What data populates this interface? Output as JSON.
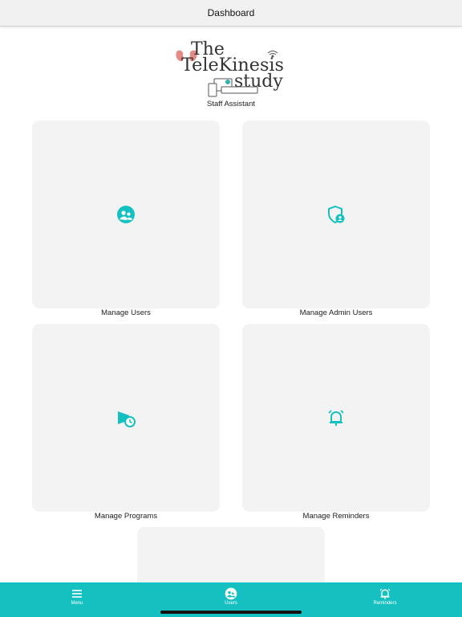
{
  "header": {
    "title": "Dashboard"
  },
  "logo": {
    "line1": "The",
    "line2": "TeleKinesis",
    "line3": "study",
    "subtitle": "Staff Assistant",
    "accent_color": "#e58a86"
  },
  "tiles": [
    {
      "label": "Manage Users",
      "icon": "users-icon"
    },
    {
      "label": "Manage Admin Users",
      "icon": "admin-shield-icon"
    },
    {
      "label": "Manage Programs",
      "icon": "program-clock-icon"
    },
    {
      "label": "Manage Reminders",
      "icon": "alarm-bell-icon"
    },
    {
      "label": "",
      "icon": ""
    }
  ],
  "tabbar": {
    "items": [
      {
        "label": "Menu",
        "icon": "menu-icon"
      },
      {
        "label": "Users",
        "icon": "users-icon"
      },
      {
        "label": "Reminders",
        "icon": "alarm-bell-icon"
      }
    ]
  },
  "colors": {
    "teal": "#15c1c0",
    "tile_bg": "#f3f3f3",
    "navbar_bg": "#f1f1f1"
  }
}
